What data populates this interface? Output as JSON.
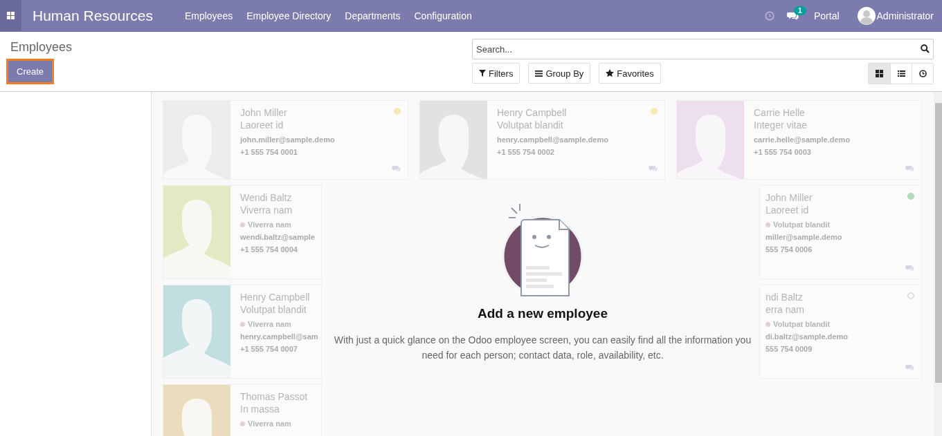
{
  "navbar": {
    "title": "Human Resources",
    "menu": [
      "Employees",
      "Employee Directory",
      "Departments",
      "Configuration"
    ],
    "messages_badge": "1",
    "portal": "Portal",
    "user": "Administrator"
  },
  "control_panel": {
    "breadcrumb": "Employees",
    "create_button": {
      "label": "Create",
      "focused": true
    },
    "search": {
      "placeholder": "Search..."
    },
    "filters": [
      {
        "kind": "filter",
        "label": "Filters"
      },
      {
        "kind": "group",
        "label": "Group By"
      },
      {
        "kind": "favorite",
        "label": "Favorites"
      }
    ],
    "views": [
      {
        "kind": "kanban",
        "selected": true
      },
      {
        "kind": "list",
        "selected": false
      },
      {
        "kind": "activity",
        "selected": false
      }
    ]
  },
  "kanban": {
    "columns": [
      {
        "cards": [
          {
            "name": "John Miller",
            "job": "Laoreet id",
            "email": "john.miller@sample.demo",
            "phone": "+1 555 754 0001",
            "status": {
              "color": "#f8e8b4",
              "filled": true
            },
            "chat": true,
            "avatar": {
              "color": "#ececec"
            }
          },
          {
            "name": "Wendi Baltz",
            "job": "Viverra nam",
            "tags": [
              {
                "label": "Viverra nam",
                "color": "#e3cfd8"
              }
            ],
            "email": "wendi.baltz@sample",
            "phone": "+1 555 754 0004",
            "avatar": {
              "color": "#e1eac2"
            }
          },
          {
            "name": "Henry Campbell",
            "job": "Volutpat blandit",
            "tags": [
              {
                "label": "Viverra nam",
                "color": "#e3cfd8"
              }
            ],
            "email": "henry.campbell@sam",
            "phone": "+1 555 754 0007",
            "avatar": {
              "color": "#c1dfe0"
            }
          },
          {
            "name": "Thomas Passot",
            "job": "In massa",
            "tags": [
              {
                "label": "Viverra nam",
                "color": "#e3cfd8"
              }
            ],
            "avatar": {
              "color": "#ecdcbe"
            }
          }
        ]
      },
      {
        "cards": [
          {
            "name": "Henry Campbell",
            "job": "Volutpat blandit",
            "email": "henry.campbell@sample.demo",
            "phone": "+1 555 754 0002",
            "status": {
              "color": "#f8e8b4",
              "filled": true
            },
            "chat": true,
            "avatar": {
              "color": "#e2e2e2"
            }
          }
        ]
      },
      {
        "cards": [
          {
            "name": "Carrie Helle",
            "job": "Integer vitae",
            "email": "carrie.helle@sample.demo",
            "phone": "+1 555 754 0003",
            "chat": true,
            "avatar": {
              "color": "#eedfee"
            }
          },
          {
            "name": "John Miller",
            "job": "Laoreet id",
            "tags": [
              {
                "label": "Volutpat blandit",
                "color": "#e3cfd8"
              }
            ],
            "email": "miller@sample.demo",
            "phone": "555 754 0006",
            "status": {
              "color": "#aedcb8",
              "filled": true
            },
            "chat": true
          },
          {
            "name": "ndi Baltz",
            "job": "erra nam",
            "tags": [
              {
                "label": "Volutpat blandit",
                "color": "#e3cfd8"
              }
            ],
            "email": "di.baltz@sample.demo",
            "phone": "555 754 0009",
            "status": {
              "color": "#dedede",
              "filled": false
            },
            "chat": true
          }
        ]
      }
    ]
  },
  "empty_state": {
    "title": "Add a new employee",
    "text": "With just a quick glance on the Odoo employee screen, you can easily find all the information you need for each person; contact data, role, availability, etc."
  }
}
